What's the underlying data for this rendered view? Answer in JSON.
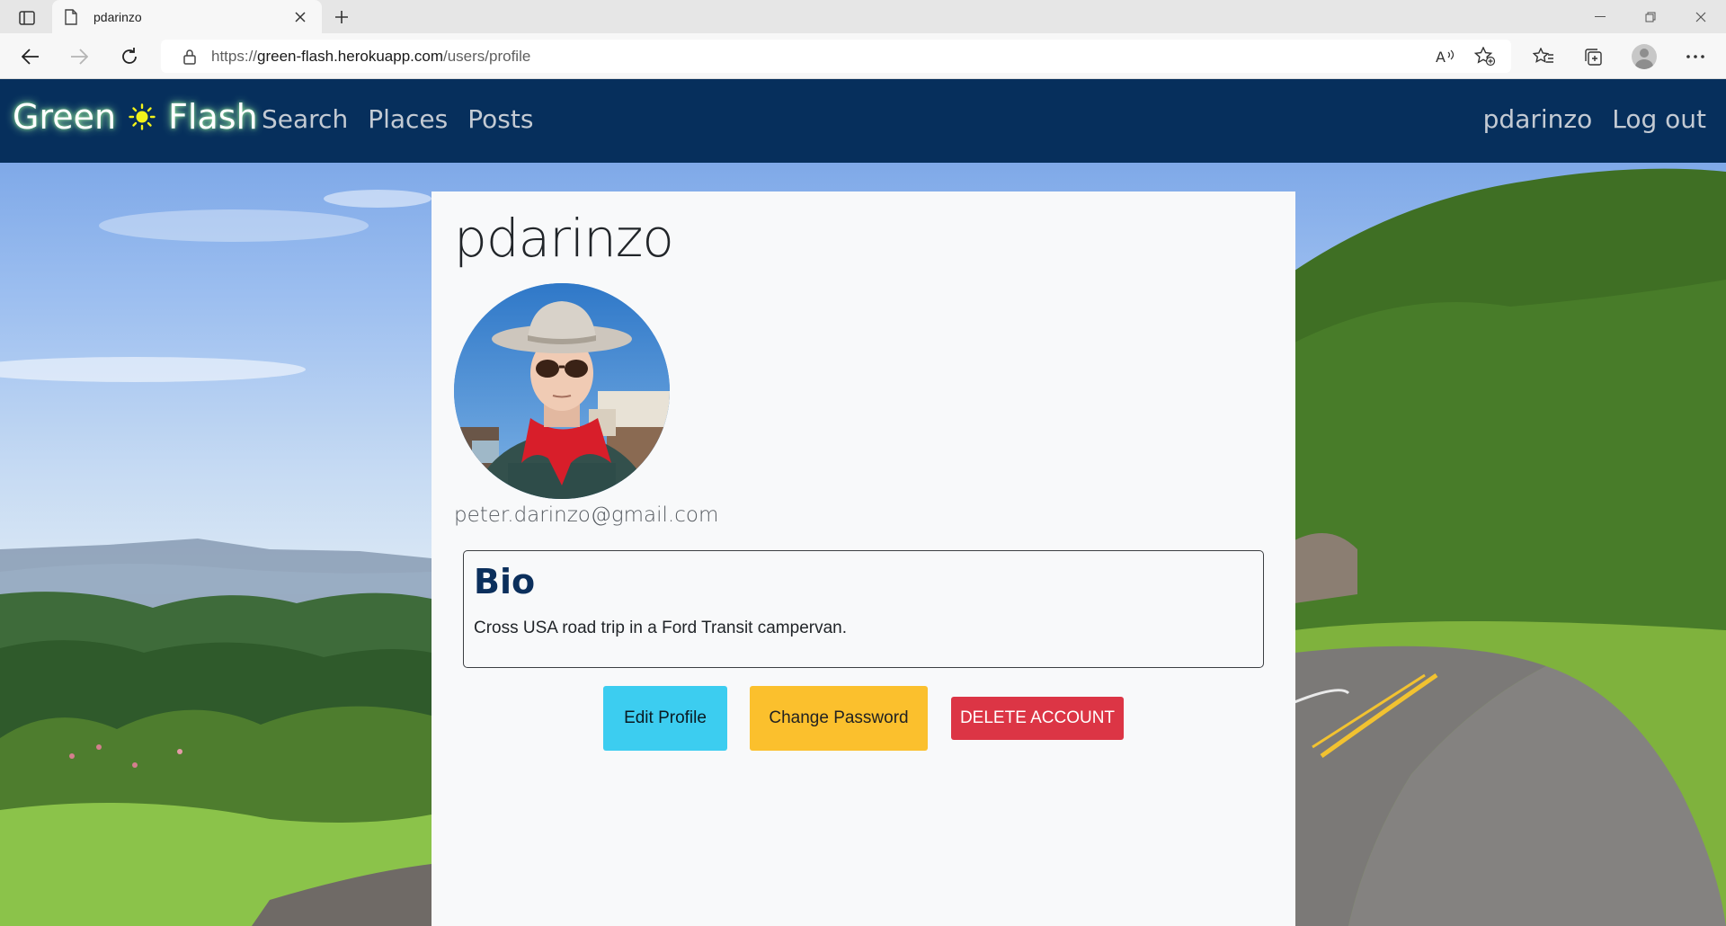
{
  "browser": {
    "tab_title": "pdarinzo",
    "url_scheme": "https://",
    "url_host": "green-flash.herokuapp.com",
    "url_path": "/users/profile"
  },
  "navbar": {
    "brand_left": "Green",
    "brand_right": "Flash",
    "links": [
      "Search",
      "Places",
      "Posts"
    ],
    "user": "pdarinzo",
    "logout": "Log out",
    "bg_color": "#062f5c"
  },
  "profile": {
    "username": "pdarinzo",
    "email": "peter.darinzo@gmail.com",
    "bio_title": "Bio",
    "bio_text": "Cross USA road trip in a Ford Transit campervan."
  },
  "actions": {
    "edit": "Edit Profile",
    "change_password": "Change Password",
    "delete": "DELETE ACCOUNT"
  },
  "colors": {
    "edit": "#3ccdf0",
    "change_password": "#fbc02d",
    "delete": "#dc3545"
  }
}
